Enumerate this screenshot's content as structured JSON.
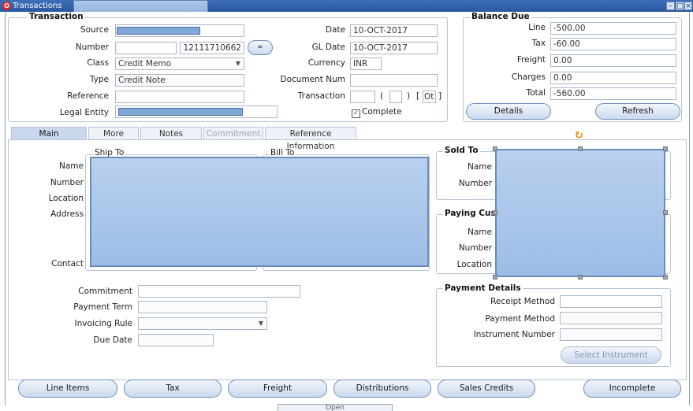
{
  "window": {
    "title": "Transactions"
  },
  "transaction": {
    "section_title": "Transaction",
    "source_label": "Source",
    "number_label": "Number",
    "number_value": "12111710662",
    "class_label": "Class",
    "class_value": "Credit Memo",
    "type_label": "Type",
    "type_value": "Credit Note",
    "reference_label": "Reference",
    "legal_entity_label": "Legal Entity",
    "date_label": "Date",
    "date_value": "10-OCT-2017",
    "gl_date_label": "GL Date",
    "gl_date_value": "10-OCT-2017",
    "currency_label": "Currency",
    "currency_value": "INR",
    "document_num_label": "Document Num",
    "transaction_label": "Transaction",
    "paren_open": "(",
    "paren_close": ")",
    "ot_value": "Ot",
    "complete_label": "Complete"
  },
  "balance_due": {
    "title": "Balance Due",
    "line_label": "Line",
    "line_value": "-500.00",
    "tax_label": "Tax",
    "tax_value": "-60.00",
    "freight_label": "Freight",
    "freight_value": "0.00",
    "charges_label": "Charges",
    "charges_value": "0.00",
    "total_label": "Total",
    "total_value": "-560.00",
    "details_button": "Details",
    "refresh_button": "Refresh"
  },
  "tabs": [
    "Main",
    "More",
    "Notes",
    "Commitment",
    "Reference Information"
  ],
  "main": {
    "ship_to_title": "Ship To",
    "bill_to_title": "Bill To",
    "name_label": "Name",
    "number_label": "Number",
    "location_label": "Location",
    "address_label": "Address",
    "contact_label": "Contact",
    "sold_to_title": "Sold To",
    "sold_name_label": "Name",
    "sold_number_label": "Number",
    "paying_title": "Paying Cus",
    "paying_name_label": "Name",
    "paying_number_label": "Number",
    "paying_location_label": "Location",
    "commitment_label": "Commitment",
    "payment_term_label": "Payment Term",
    "invoicing_rule_label": "Invoicing Rule",
    "due_date_label": "Due Date",
    "payment_details_title": "Payment Details",
    "receipt_method_label": "Receipt Method",
    "payment_method_label": "Payment Method",
    "instrument_number_label": "Instrument Number",
    "select_instrument_button": "Select Instrument"
  },
  "bottom_buttons": [
    "Line Items",
    "Tax",
    "Freight",
    "Distributions",
    "Sales Credits",
    "Incomplete"
  ],
  "bottom_partial_label": "Open",
  "colors": {
    "title_bar": "#2a58a0",
    "selection_blue": "#9dbde6",
    "tab_active": "#c9d8ec"
  }
}
